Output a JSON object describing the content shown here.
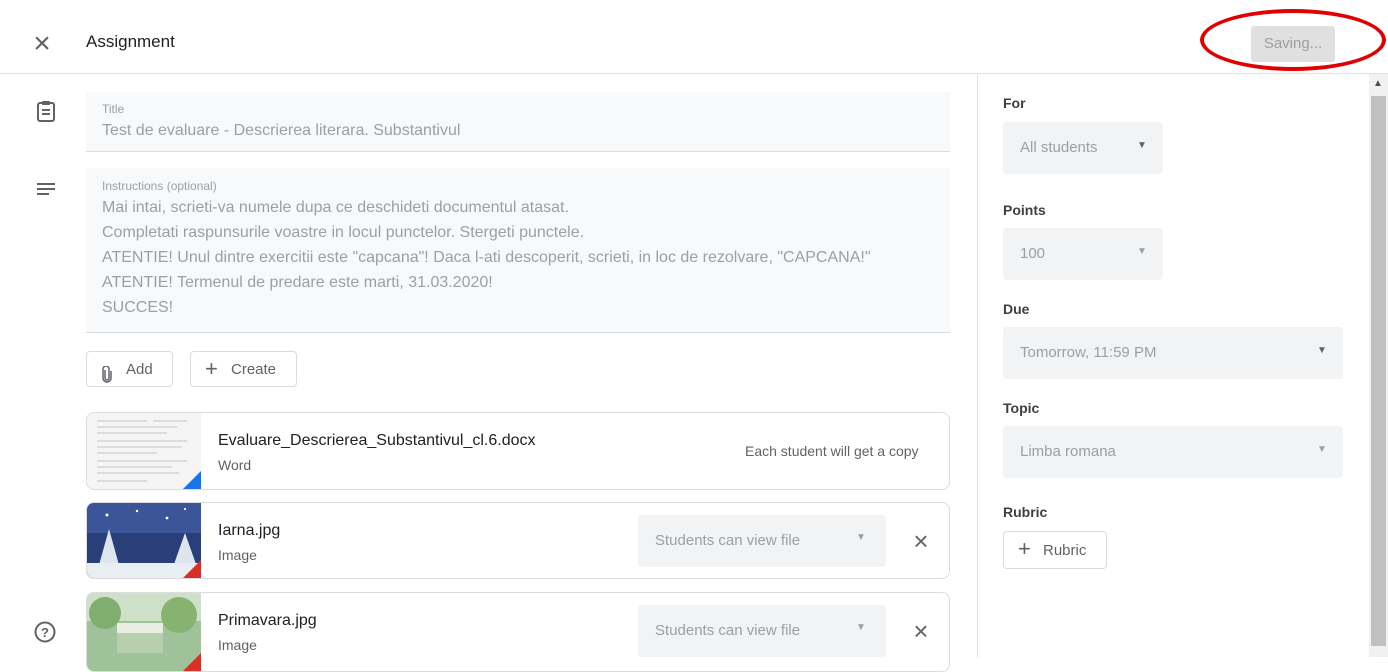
{
  "header": {
    "title": "Assignment",
    "save_label": "Saving..."
  },
  "title_field": {
    "label": "Title",
    "value": "Test de evaluare - Descrierea literara. Substantivul"
  },
  "instructions_field": {
    "label": "Instructions (optional)",
    "lines": [
      "Mai intai, scrieti-va numele dupa ce deschideti documentul atasat.",
      "Completati raspunsurile voastre in locul punctelor. Stergeti punctele.",
      "ATENTIE! Unul dintre exercitii este \"capcana\"! Daca l-ati descoperit, scrieti, in loc de rezolvare, \"CAPCANA!\"",
      "ATENTIE! Termenul de predare este marti, 31.03.2020!",
      "SUCCES!"
    ]
  },
  "actions": {
    "add_label": "Add",
    "create_label": "Create"
  },
  "attachments": [
    {
      "name": "Evaluare_Descrierea_Substantivul_cl.6.docx",
      "type": "Word",
      "note": "Each student will get a copy"
    },
    {
      "name": "Iarna.jpg",
      "type": "Image",
      "permission": "Students can view file"
    },
    {
      "name": "Primavara.jpg",
      "type": "Image",
      "permission": "Students can view file"
    }
  ],
  "sidebar": {
    "for_label": "For",
    "for_value": "All students",
    "points_label": "Points",
    "points_value": "100",
    "due_label": "Due",
    "due_value": "Tomorrow, 11:59 PM",
    "topic_label": "Topic",
    "topic_value": "Limba romana",
    "rubric_label": "Rubric",
    "rubric_button": "Rubric"
  },
  "icons": {
    "close": "close-icon",
    "assignment": "clipboard-icon",
    "instructions": "text-lines-icon",
    "attach": "paperclip-icon",
    "plus": "plus-icon",
    "help": "help-icon",
    "dropdown": "dropdown-arrow-icon"
  },
  "colors": {
    "highlight": "#e00000",
    "word_corner": "#1a73e8",
    "image_corner": "#d93025"
  }
}
